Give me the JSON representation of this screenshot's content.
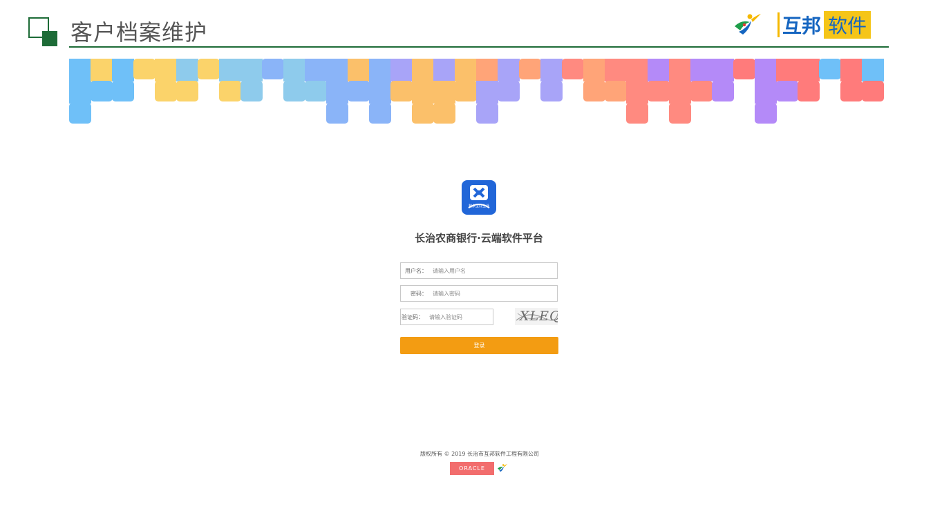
{
  "header": {
    "title": "客户档案维护",
    "brand_name_a": "互邦",
    "brand_name_b": "软件",
    "accent_color": "#1d6b37"
  },
  "banner": {
    "palette": [
      "#6fc0f8",
      "#fbd36a",
      "#8ecbec",
      "#8ab4f8",
      "#fbc06a",
      "#a8a4f8",
      "#ffa478",
      "#ff8a80",
      "#b48af8",
      "#ff7b7b"
    ]
  },
  "login": {
    "app_logo_text": "剩余宝好生活",
    "title": "长治农商银行·云端软件平台",
    "username_label": "用户名：",
    "username_placeholder": "请输入用户名",
    "password_label": "密码：",
    "password_placeholder": "请输入密码",
    "captcha_label": "验证码：",
    "captcha_placeholder": "请输入验证码",
    "captcha_text": "XLEQ",
    "submit_label": "登录",
    "button_color": "#f39c12"
  },
  "footer": {
    "copyright": "版权所有 © 2019 长治市互邦软件工程有限公司",
    "oracle_badge": "ORACLE"
  }
}
